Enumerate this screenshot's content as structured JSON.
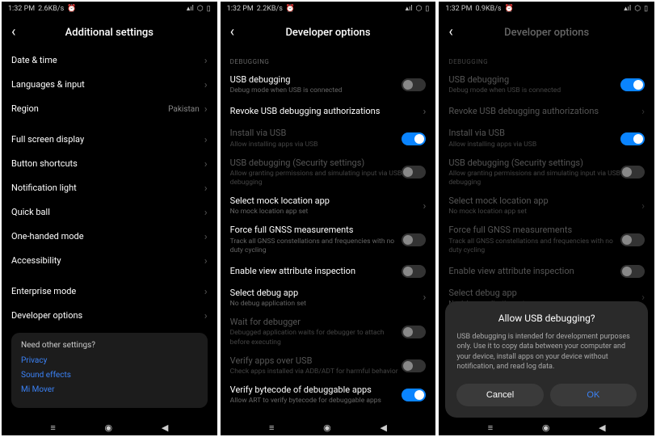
{
  "status": {
    "time": "1:32 PM",
    "net1": "2.6KB/s",
    "net2": "2.2KB/s",
    "net3": "0.9KB/s",
    "alarm": "⏰",
    "signal": "📶",
    "wifi": "📶",
    "battery": "▮"
  },
  "screen1": {
    "title": "Additional settings",
    "items": [
      {
        "label": "Date & time"
      },
      {
        "label": "Languages & input"
      },
      {
        "label": "Region",
        "value": "Pakistan"
      }
    ],
    "items2": [
      {
        "label": "Full screen display"
      },
      {
        "label": "Button shortcuts"
      },
      {
        "label": "Notification light"
      },
      {
        "label": "Quick ball"
      },
      {
        "label": "One-handed mode"
      },
      {
        "label": "Accessibility"
      }
    ],
    "items3": [
      {
        "label": "Enterprise mode"
      },
      {
        "label": "Developer options"
      }
    ],
    "card": {
      "heading": "Need other settings?",
      "links": [
        "Privacy",
        "Sound effects",
        "Mi Mover"
      ]
    }
  },
  "screen2": {
    "title": "Developer options",
    "section": "DEBUGGING",
    "items": [
      {
        "label": "USB debugging",
        "sub": "Debug mode when USB is connected",
        "toggle": "off"
      },
      {
        "label": "Revoke USB debugging authorizations",
        "chevron": true
      },
      {
        "label": "Install via USB",
        "sub": "Allow installing apps via USB",
        "toggle": "on",
        "disabled": true
      },
      {
        "label": "USB debugging (Security settings)",
        "sub": "Allow granting permissions and simulating input via USB debugging",
        "toggle": "off",
        "disabled": true
      },
      {
        "label": "Select mock location app",
        "sub": "No mock location app set",
        "chevron": true
      },
      {
        "label": "Force full GNSS measurements",
        "sub": "Track all GNSS constellations and frequencies with no duty cycling",
        "toggle": "off"
      },
      {
        "label": "Enable view attribute inspection",
        "toggle": "off"
      },
      {
        "label": "Select debug app",
        "sub": "No debug application set",
        "chevron": true
      },
      {
        "label": "Wait for debugger",
        "sub": "Debugged application waits for debugger to attach before executing",
        "toggle": "off",
        "disabled": true
      },
      {
        "label": "Verify apps over USB",
        "sub": "Check apps installed via ADB/ADT for harmful behavior",
        "toggle": "off",
        "disabled": true
      },
      {
        "label": "Verify bytecode of debuggable apps",
        "sub": "Allow ART to verify bytecode for debuggable apps",
        "toggle": "on"
      }
    ]
  },
  "screen3": {
    "title": "Developer options",
    "section": "DEBUGGING",
    "items": [
      {
        "label": "USB debugging",
        "sub": "Debug mode when USB is connected",
        "toggle": "on"
      },
      {
        "label": "Revoke USB debugging authorizations",
        "chevron": true
      },
      {
        "label": "Install via USB",
        "sub": "Allow installing apps via USB",
        "toggle": "on"
      },
      {
        "label": "USB debugging (Security settings)",
        "sub": "Allow granting permissions and simulating input via USB debugging",
        "toggle": "off"
      },
      {
        "label": "Select mock location app",
        "sub": "No mock location app set",
        "chevron": true
      },
      {
        "label": "Force full GNSS measurements",
        "sub": "Track all GNSS constellations and frequencies with no duty cycling",
        "toggle": "off"
      },
      {
        "label": "Enable view attribute inspection",
        "toggle": "off"
      },
      {
        "label": "Select debug app",
        "sub": "No debug application set",
        "chevron": true
      }
    ],
    "dialog": {
      "title": "Allow USB debugging?",
      "body": "USB debugging is intended for development purposes only. Use it to copy data between your computer and your device, install apps on your device without notification, and read log data.",
      "cancel": "Cancel",
      "ok": "OK"
    }
  },
  "nav": {
    "menu": "☰",
    "home": "◉",
    "back": "◀"
  }
}
